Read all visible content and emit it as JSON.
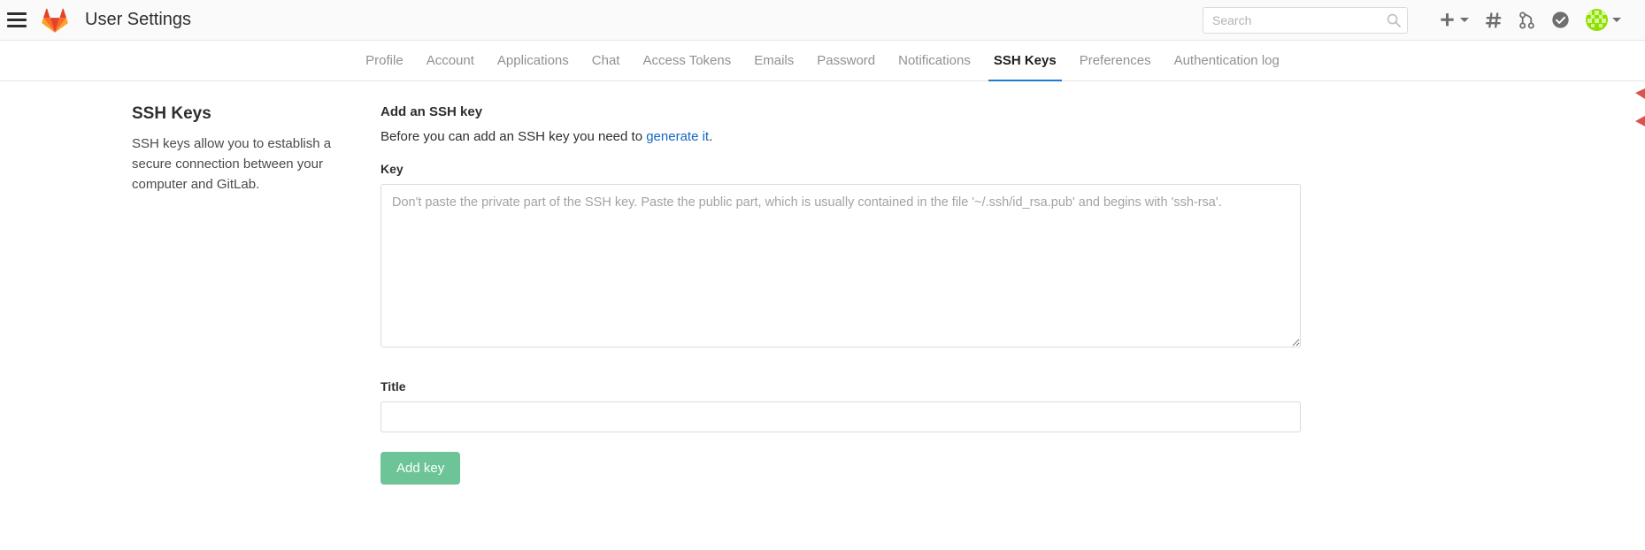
{
  "navbar": {
    "menu_icon": "hamburger-icon",
    "logo_icon": "gitlab-logo-icon",
    "title": "User Settings",
    "search": {
      "placeholder": "Search",
      "value": "",
      "icon": "search-icon"
    },
    "icons": [
      {
        "name": "plus-icon",
        "glyph": "+"
      },
      {
        "name": "issues-hash-icon",
        "glyph": "#"
      },
      {
        "name": "merge-requests-icon",
        "glyph": "branch"
      },
      {
        "name": "todos-check-icon",
        "glyph": "check-circle"
      }
    ],
    "avatar": "user-avatar-identicon"
  },
  "tabs": [
    {
      "label": "Profile",
      "active": false
    },
    {
      "label": "Account",
      "active": false
    },
    {
      "label": "Applications",
      "active": false
    },
    {
      "label": "Chat",
      "active": false
    },
    {
      "label": "Access Tokens",
      "active": false
    },
    {
      "label": "Emails",
      "active": false
    },
    {
      "label": "Password",
      "active": false
    },
    {
      "label": "Notifications",
      "active": false
    },
    {
      "label": "SSH Keys",
      "active": true
    },
    {
      "label": "Preferences",
      "active": false
    },
    {
      "label": "Authentication log",
      "active": false
    }
  ],
  "aside": {
    "heading": "SSH Keys",
    "description": "SSH keys allow you to establish a secure connection between your computer and GitLab."
  },
  "form": {
    "heading": "Add an SSH key",
    "hint_before": "Before you can add an SSH key you need to ",
    "hint_link": "generate it",
    "hint_after": ".",
    "key_label": "Key",
    "key_value": "",
    "key_placeholder": "Don't paste the private part of the SSH key. Paste the public part, which is usually contained in the file '~/.ssh/id_rsa.pub' and begins with 'ssh-rsa'.",
    "title_label": "Title",
    "title_value": "",
    "title_placeholder": "",
    "submit_label": "Add key"
  },
  "colors": {
    "accent_blue": "#1f78d1",
    "link_blue": "#1068bf",
    "button_green": "#6cc497",
    "navbar_bg": "#fafafa",
    "logo_orange": "#e24329",
    "logo_amber": "#fc6d26",
    "avatar_green": "#7ed321"
  }
}
